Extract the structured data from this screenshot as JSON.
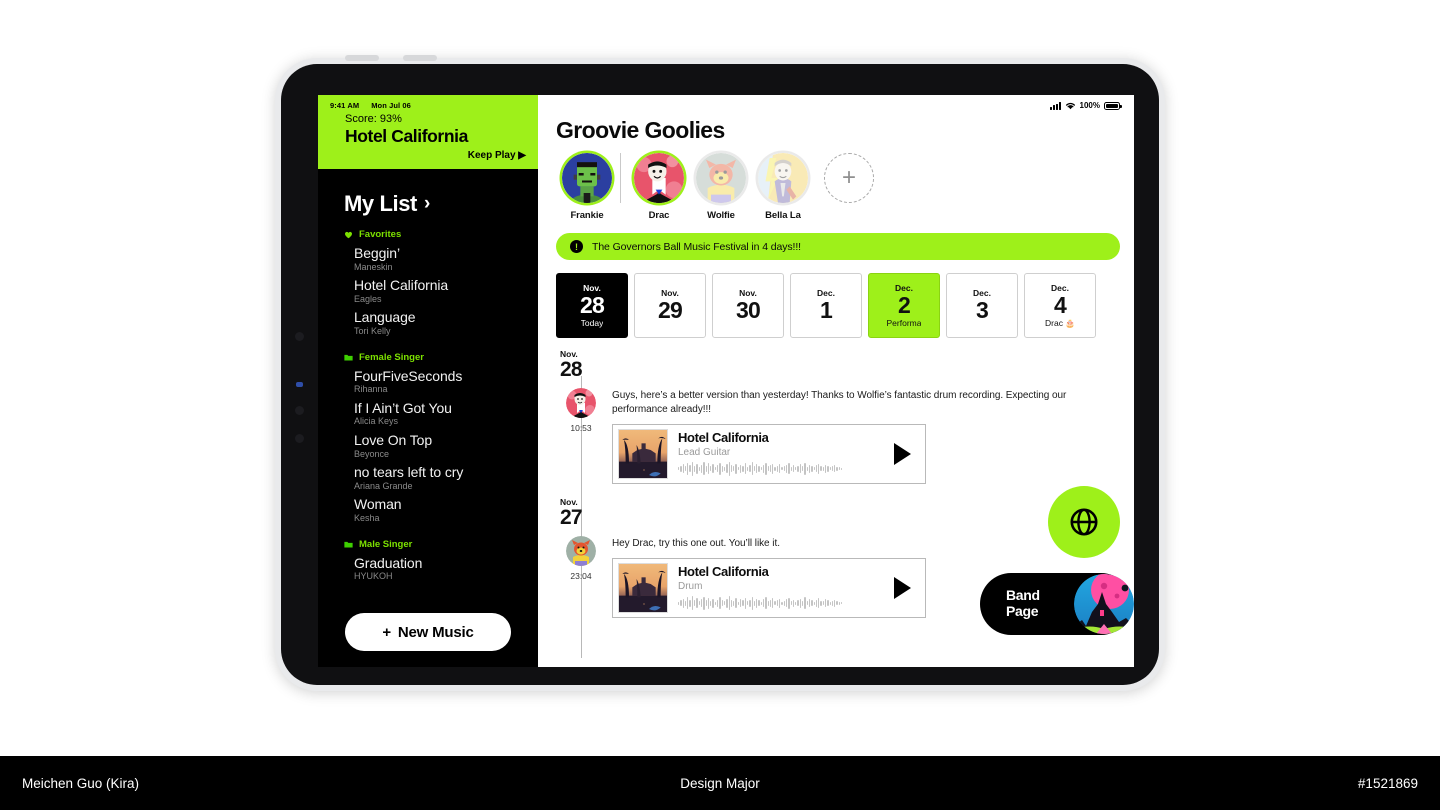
{
  "footer": {
    "author": "Meichen Guo (Kira)",
    "major": "Design Major",
    "id": "#1521869"
  },
  "status_bar": {
    "time": "9:41 AM",
    "date": "Mon Jul 06",
    "battery": "100%",
    "wifi_icon": "wifi-icon",
    "signal_icon": "signal-bars-icon",
    "battery_icon": "battery-full-icon"
  },
  "now_playing": {
    "score_label": "Score: 93%",
    "title": "Hotel California",
    "keep_play": "Keep Play ▶"
  },
  "sidebar": {
    "title": "My List",
    "chevron": "›",
    "new_music_button": "New Music",
    "new_music_plus": "+",
    "sections": [
      {
        "label": "Favorites",
        "icon": "heart-icon",
        "tracks": [
          {
            "name": "Beggin’",
            "artist": "Maneskin"
          },
          {
            "name": "Hotel California",
            "artist": "Eagles"
          },
          {
            "name": "Language",
            "artist": "Tori Kelly"
          }
        ]
      },
      {
        "label": "Female Singer",
        "icon": "folder-icon",
        "tracks": [
          {
            "name": "FourFiveSeconds",
            "artist": "Rihanna"
          },
          {
            "name": "If I Ain’t Got You",
            "artist": "Alicia Keys"
          },
          {
            "name": "Love On Top",
            "artist": "Beyonce"
          },
          {
            "name": "no tears left to cry",
            "artist": "Ariana Grande"
          },
          {
            "name": "Woman",
            "artist": "Kesha"
          }
        ]
      },
      {
        "label": "Male Singer",
        "icon": "folder-icon",
        "tracks": [
          {
            "name": "Graduation",
            "artist": "HYUKOH"
          }
        ]
      }
    ]
  },
  "main": {
    "page_title": "Groovie Goolies",
    "add_member_label": "+",
    "members": [
      {
        "name": "Frankie",
        "online": true
      },
      {
        "name": "Drac",
        "online": true
      },
      {
        "name": "Wolfie",
        "online": false
      },
      {
        "name": "Bella La",
        "online": false
      }
    ],
    "banner": {
      "icon": "alert-exclamation-icon",
      "text": "The Governors Ball Music Festival in 4 days!!!"
    },
    "dates": [
      {
        "month": "Nov.",
        "day": "28",
        "sub": "Today",
        "state": "today"
      },
      {
        "month": "Nov.",
        "day": "29",
        "sub": "",
        "state": "normal"
      },
      {
        "month": "Nov.",
        "day": "30",
        "sub": "",
        "state": "normal"
      },
      {
        "month": "Dec.",
        "day": "1",
        "sub": "",
        "state": "normal"
      },
      {
        "month": "Dec.",
        "day": "2",
        "sub": "Performa",
        "state": "active"
      },
      {
        "month": "Dec.",
        "day": "3",
        "sub": "",
        "state": "normal"
      },
      {
        "month": "Dec.",
        "day": "4",
        "sub": "Drac",
        "state": "birthday"
      }
    ],
    "timeline": [
      {
        "month": "Nov.",
        "day": "28",
        "messages": [
          {
            "time": "10:53",
            "author": "Drac",
            "text": "Guys, here’s a better version than yesterday! Thanks to Wolfie’s fantastic drum recording. Expecting our performance already!!!",
            "audio": {
              "title": "Hotel California",
              "part": "Lead Guitar",
              "play_icon": "play-icon"
            }
          }
        ]
      },
      {
        "month": "Nov.",
        "day": "27",
        "messages": [
          {
            "time": "23:04",
            "author": "Wolfie",
            "text": "Hey Drac, try this one out. You’ll like it.",
            "audio": {
              "title": "Hotel California",
              "part": "Drum",
              "play_icon": "play-icon"
            }
          }
        ]
      }
    ],
    "globe_button": {
      "icon": "globe-icon"
    },
    "band_page_button": {
      "line1": "Band",
      "line2": "Page"
    }
  },
  "colors": {
    "accent_green": "#9EF01A",
    "black": "#000000",
    "sidebar_bg": "#000000",
    "muted_text": "#8a8a8a"
  }
}
